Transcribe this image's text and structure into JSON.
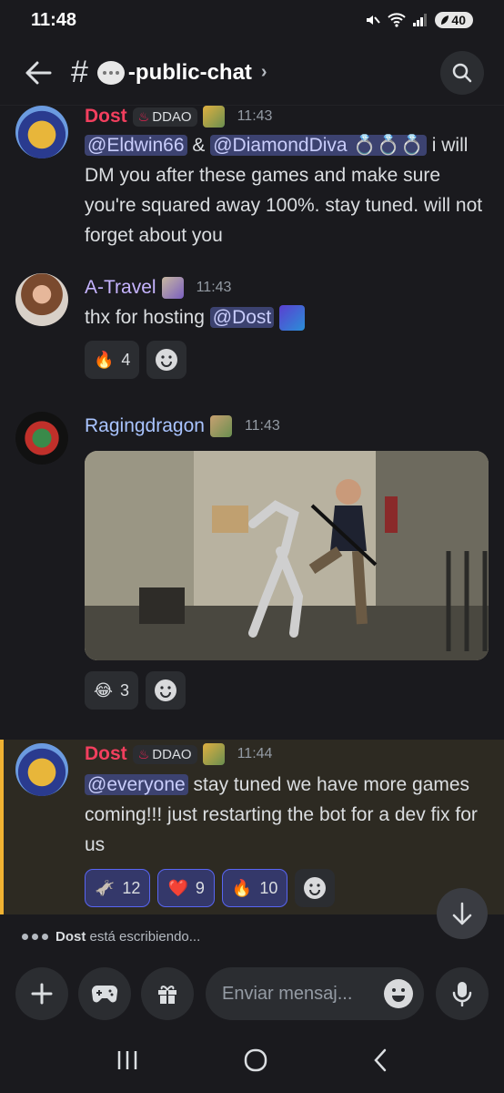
{
  "status_bar": {
    "time": "11:48",
    "battery": "40"
  },
  "header": {
    "channel_name": "-public-chat"
  },
  "messages": [
    {
      "author": "Dost",
      "tag": "DDAO",
      "time": "11:43",
      "segments": {
        "m1": "@Eldwin66",
        "t1": " & ",
        "m2": "@DiamondDiva",
        "t2": "💍💍💍",
        "t3": " i will DM you after these games and make sure you're squared away 100%. stay tuned. will not forget about you"
      }
    },
    {
      "author": "A-Travel",
      "time": "11:43",
      "segments": {
        "t1": "thx for hosting ",
        "m1": "@Dost"
      },
      "reactions": [
        {
          "emoji": "🔥",
          "count": "4"
        }
      ]
    },
    {
      "author": "Ragingdragon",
      "time": "11:43",
      "reactions": [
        {
          "emoji": "😂",
          "count": "3"
        }
      ]
    },
    {
      "author": "Dost",
      "tag": "DDAO",
      "time": "11:44",
      "segments": {
        "m1": "@everyone",
        "t1": " stay tuned we have more games coming!!! just restarting the bot for a dev fix for us"
      },
      "reactions": [
        {
          "emoji": "🫏",
          "count": "12"
        },
        {
          "emoji": "❤️",
          "count": "9"
        },
        {
          "emoji": "🔥",
          "count": "10"
        }
      ]
    }
  ],
  "typing": {
    "user": "Dost",
    "text": "está escribiendo..."
  },
  "composer": {
    "placeholder": "Enviar mensaj..."
  },
  "colors": {
    "accent": "#5865f2",
    "mention_bg": "#3c4270",
    "highlight": "#f0b232",
    "dost_name": "#f23f5e"
  }
}
